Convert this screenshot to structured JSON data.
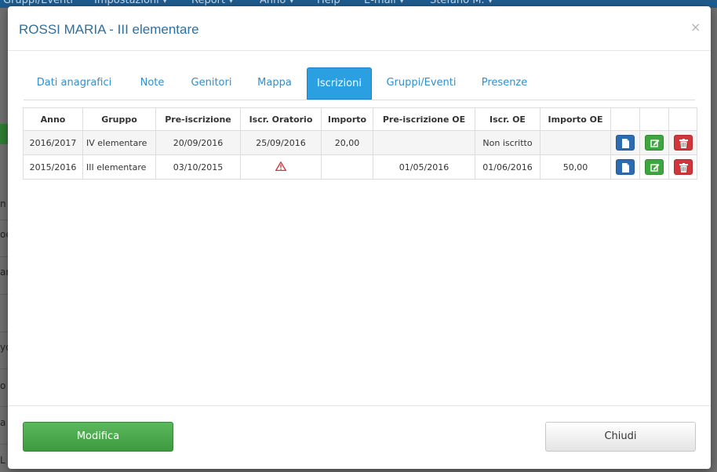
{
  "background": {
    "nav_items": [
      "Gruppi/Eventi",
      "Impostazioni ▾",
      "Report ▾",
      "Anno ▾",
      "Help",
      "E-mail ▾",
      "Stefano M. ▾"
    ],
    "left_letters": [
      "n",
      "oc",
      "ar",
      "yo",
      "o",
      "a",
      "L"
    ]
  },
  "modal": {
    "title": "ROSSI MARIA - III elementare",
    "close": "×",
    "tabs": [
      {
        "label": "Dati anagrafici",
        "active": false
      },
      {
        "label": "Note",
        "active": false
      },
      {
        "label": "Genitori",
        "active": false
      },
      {
        "label": "Mappa",
        "active": false
      },
      {
        "label": "Iscrizioni",
        "active": true
      },
      {
        "label": "Gruppi/Eventi",
        "active": false
      },
      {
        "label": "Presenze",
        "active": false
      }
    ],
    "table": {
      "headers": [
        "Anno",
        "Gruppo",
        "Pre-iscrizione",
        "Iscr. Oratorio",
        "Importo",
        "Pre-iscrizione OE",
        "Iscr. OE",
        "Importo OE",
        "",
        "",
        ""
      ],
      "rows": [
        {
          "anno": "2016/2017",
          "gruppo": "IV elementare",
          "pre_iscrizione": "20/09/2016",
          "iscr_oratorio": "25/09/2016",
          "importo": "20,00",
          "pre_iscrizione_oe": "",
          "iscr_oe": "Non iscritto",
          "importo_oe": ""
        },
        {
          "anno": "2015/2016",
          "gruppo": "III elementare",
          "pre_iscrizione": "03/10/2015",
          "iscr_oratorio": "",
          "iscr_oratorio_icon": "warning-icon",
          "importo": "",
          "pre_iscrizione_oe": "01/05/2016",
          "iscr_oe": "01/06/2016",
          "importo_oe": "50,00"
        }
      ],
      "actions": [
        "document-icon",
        "edit-icon",
        "trash-icon"
      ]
    },
    "footer": {
      "modifica_label": "Modifica",
      "chiudi_label": "Chiudi"
    }
  },
  "colors": {
    "accent": "#2a9fe2",
    "title": "#2f6f9f",
    "success": "#5cb85c",
    "danger": "#d0363a",
    "primary": "#2d6bb0"
  }
}
